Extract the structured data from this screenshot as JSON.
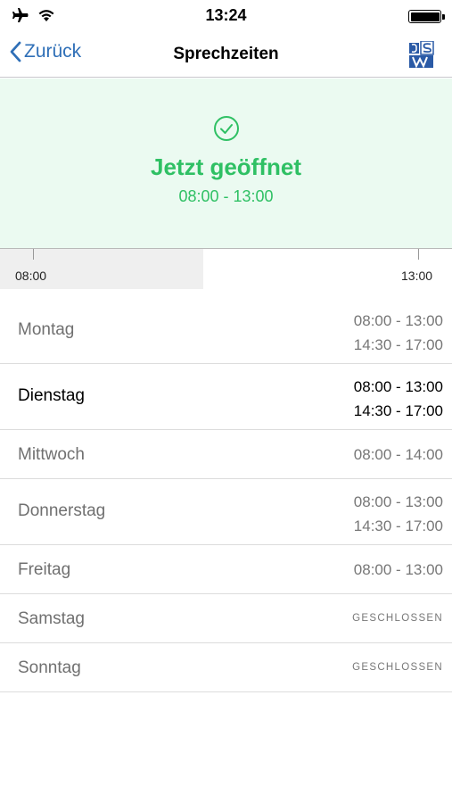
{
  "status_bar": {
    "time": "13:24",
    "icons": [
      "airplane-icon",
      "wifi-icon",
      "battery-icon"
    ]
  },
  "nav": {
    "back_label": "Zurück",
    "title": "Sprechzeiten",
    "logo_icon": "csw-logo-icon"
  },
  "open_status": {
    "title": "Jetzt geöffnet",
    "hours": "08:00 - 13:00",
    "icon": "check-circle-icon",
    "color": "#2fc064",
    "background": "#ebfaf1"
  },
  "timeline": {
    "start_label": "08:00",
    "end_label": "13:00",
    "elapsed_fraction": 0.45
  },
  "schedule": [
    {
      "day": "Montag",
      "times": [
        "08:00 - 13:00",
        "14:30 - 17:00"
      ],
      "today": false,
      "closed": false
    },
    {
      "day": "Dienstag",
      "times": [
        "08:00 - 13:00",
        "14:30 - 17:00"
      ],
      "today": true,
      "closed": false
    },
    {
      "day": "Mittwoch",
      "times": [
        "08:00 - 14:00"
      ],
      "today": false,
      "closed": false
    },
    {
      "day": "Donnerstag",
      "times": [
        "08:00 - 13:00",
        "14:30 - 17:00"
      ],
      "today": false,
      "closed": false
    },
    {
      "day": "Freitag",
      "times": [
        "08:00 - 13:00"
      ],
      "today": false,
      "closed": false
    },
    {
      "day": "Samstag",
      "times": [],
      "closed_label": "GESCHLOSSEN",
      "today": false,
      "closed": true
    },
    {
      "day": "Sonntag",
      "times": [],
      "closed_label": "GESCHLOSSEN",
      "today": false,
      "closed": true
    }
  ]
}
